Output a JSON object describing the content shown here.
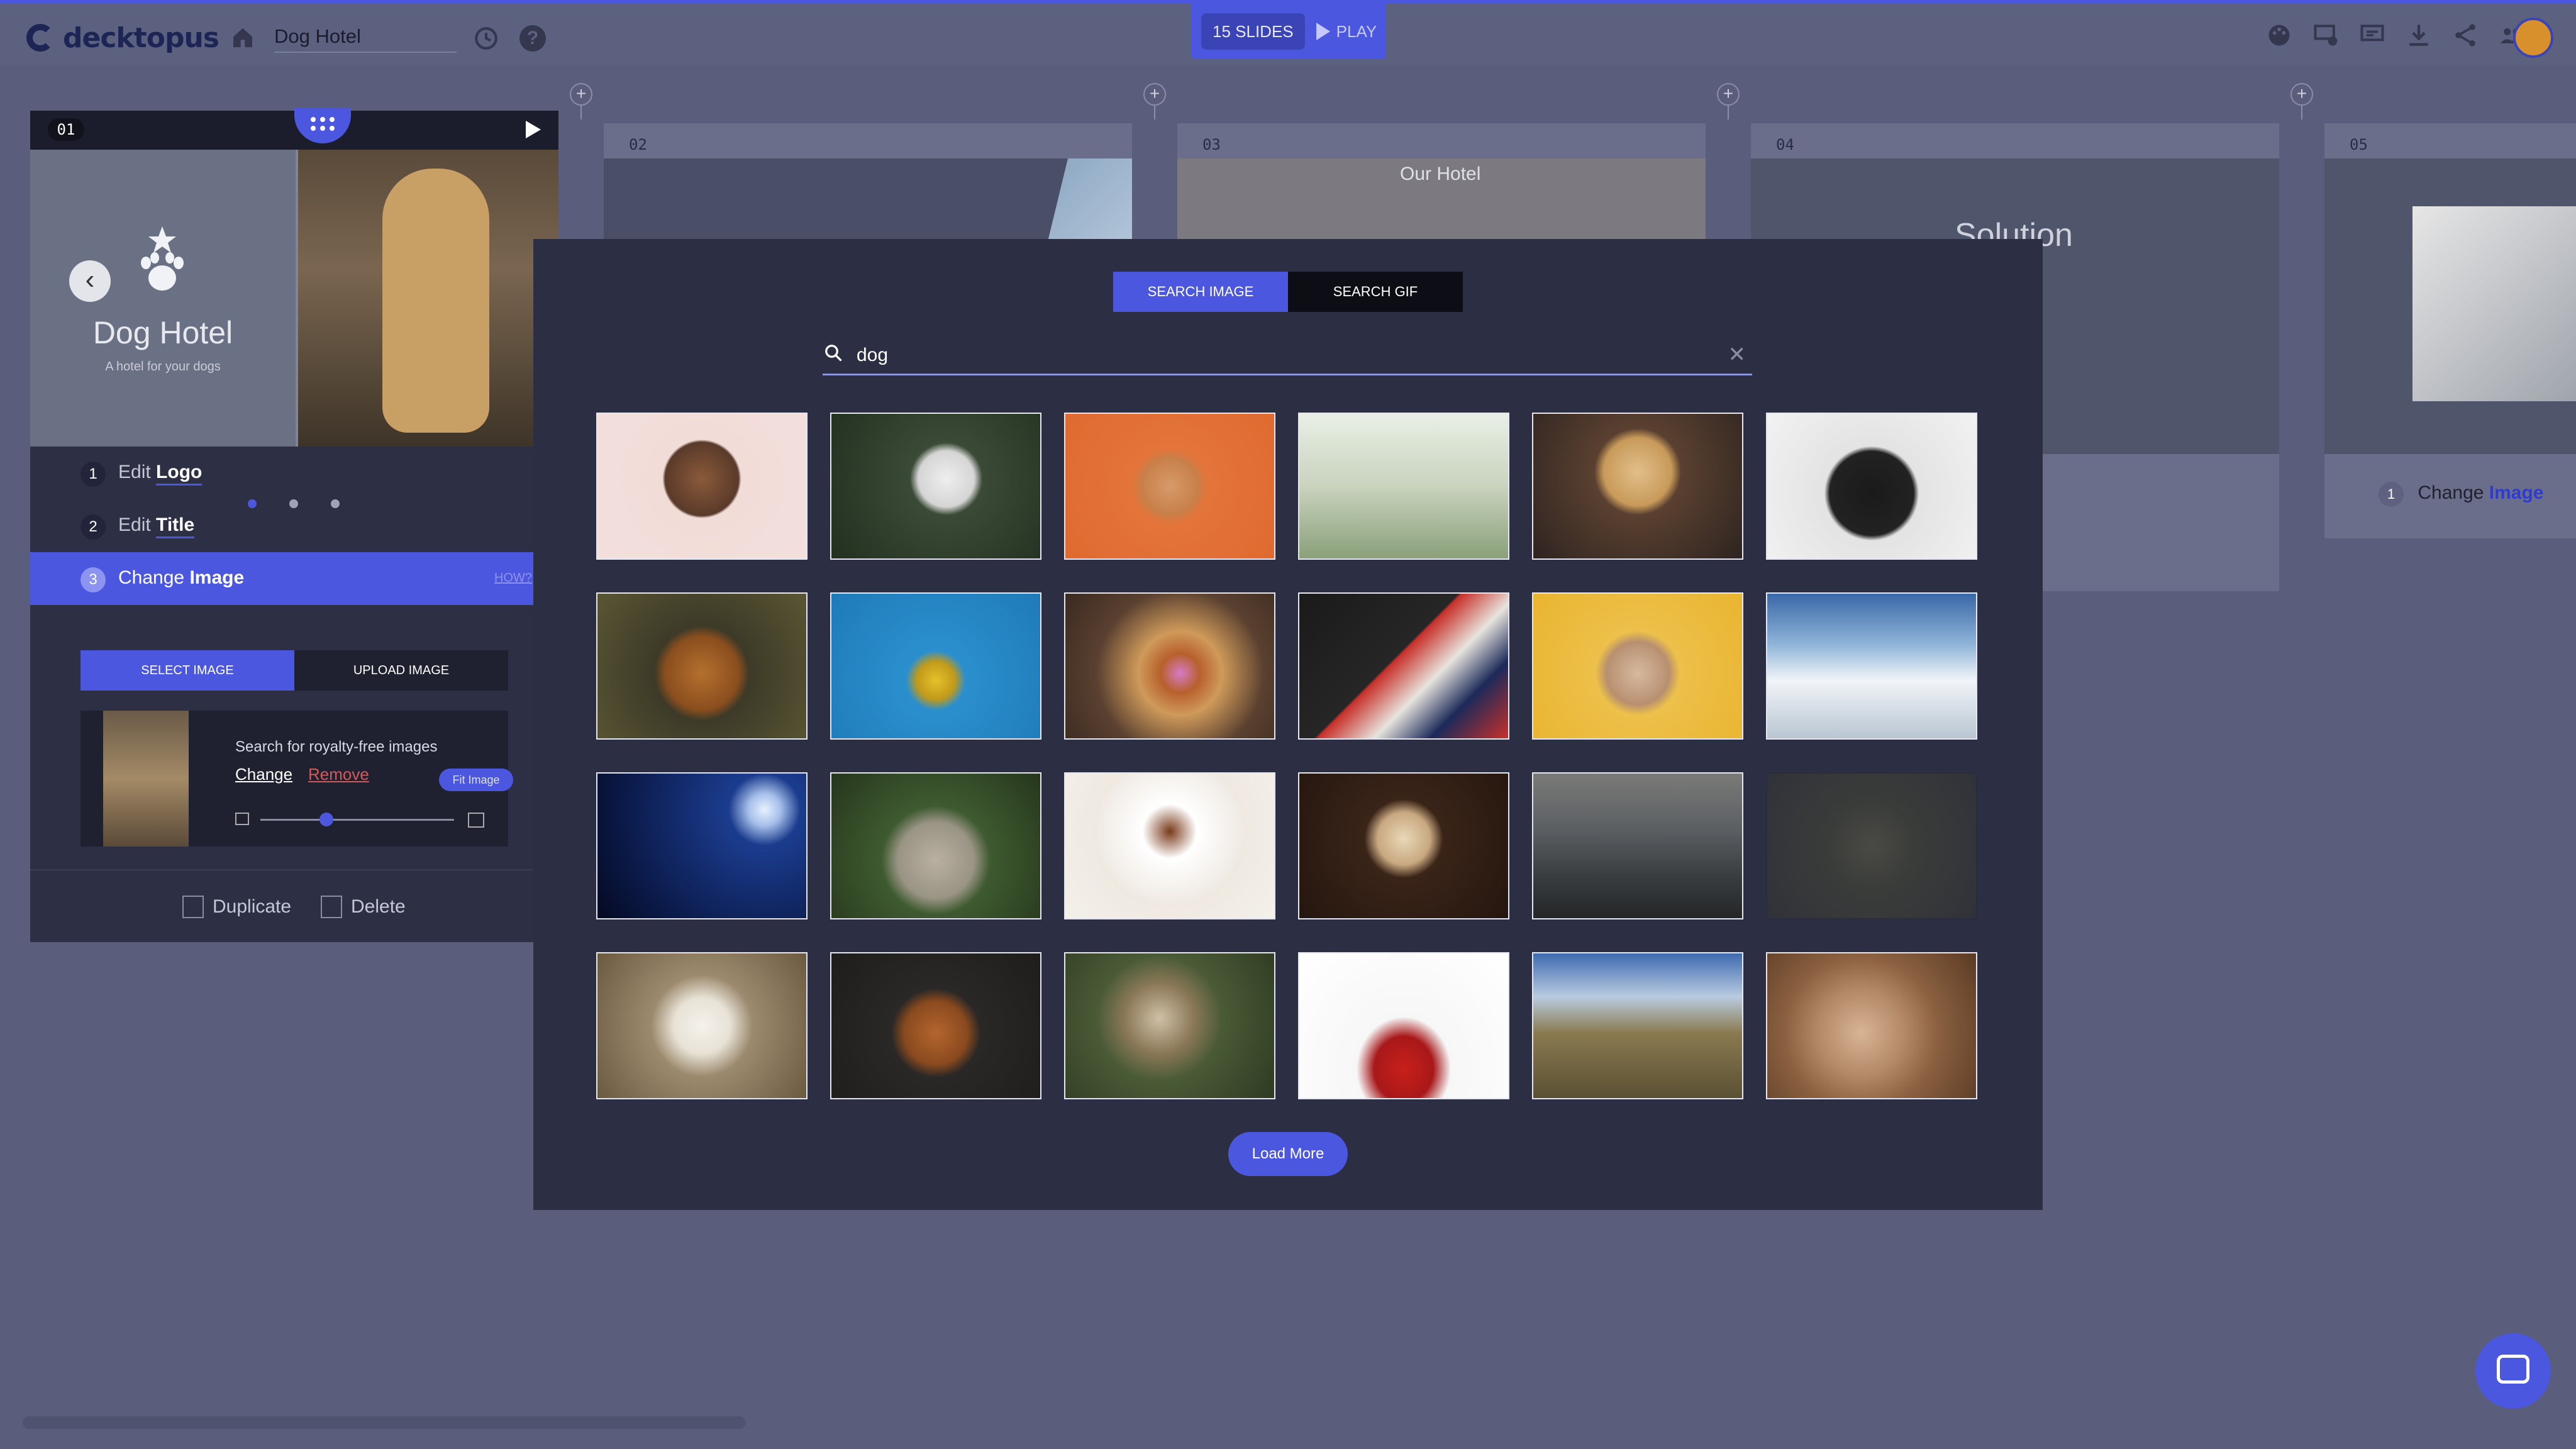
{
  "app": {
    "brand": "decktopus",
    "doc_title": "Dog Hotel"
  },
  "toolbar": {
    "slides_count": "15 SLIDES",
    "play_label": "PLAY"
  },
  "slides": [
    {
      "num": "01",
      "title": "Dog Hotel",
      "subtitle": "A hotel for your dogs"
    },
    {
      "num": "02"
    },
    {
      "num": "03",
      "text": "Our Hotel"
    },
    {
      "num": "04",
      "text": "Solution"
    },
    {
      "num": "05",
      "step_num": "1",
      "step_verb": "Change",
      "step_obj": "Image"
    }
  ],
  "editor": {
    "slide_badge": "01",
    "steps": [
      {
        "num": "1",
        "verb": "Edit",
        "obj": "Logo"
      },
      {
        "num": "2",
        "verb": "Edit",
        "obj": "Title"
      },
      {
        "num": "3",
        "verb": "Change",
        "obj": "Image",
        "how": "HOW?"
      }
    ],
    "tabs": {
      "select": "SELECT IMAGE",
      "upload": "UPLOAD IMAGE"
    },
    "panel": {
      "search_text": "Search for royalty-free images",
      "change": "Change",
      "remove": "Remove",
      "fit": "Fit Image"
    },
    "footer": {
      "duplicate": "Duplicate",
      "delete": "Delete"
    }
  },
  "modal": {
    "tab_image": "SEARCH IMAGE",
    "tab_gif": "SEARCH GIF",
    "search_value": "dog",
    "load_more": "Load More",
    "images": [
      "jack-russell-portrait",
      "white-puppy-running-grass",
      "corgi-orange-background",
      "two-dogs-in-grass",
      "golden-retriever-with-flower",
      "black-pug-closeup",
      "spaniel-in-forest",
      "french-bulldog-yellow-sweater",
      "golden-retriever-pink-flower",
      "black-dog-striped-shirt",
      "french-bulldog-yellow-bg",
      "dog-running-beach",
      "night-sky-tree-dog-silhouette",
      "pug-in-blanket",
      "cavalier-spaniel-lying",
      "pug-on-wood-floor",
      "people-sitting-with-dog",
      "dark-dog-sketch",
      "white-lab-puppy",
      "vizsla-dark-background",
      "cat-and-dog-cuddling",
      "french-bulldog-red-cushion",
      "mountain-landscape-dog",
      "french-bulldog-sleeping"
    ]
  },
  "colors": {
    "accent": "#4c57e0",
    "modal_bg": "#2c2e44",
    "page_bg": "#5a5e7c"
  }
}
